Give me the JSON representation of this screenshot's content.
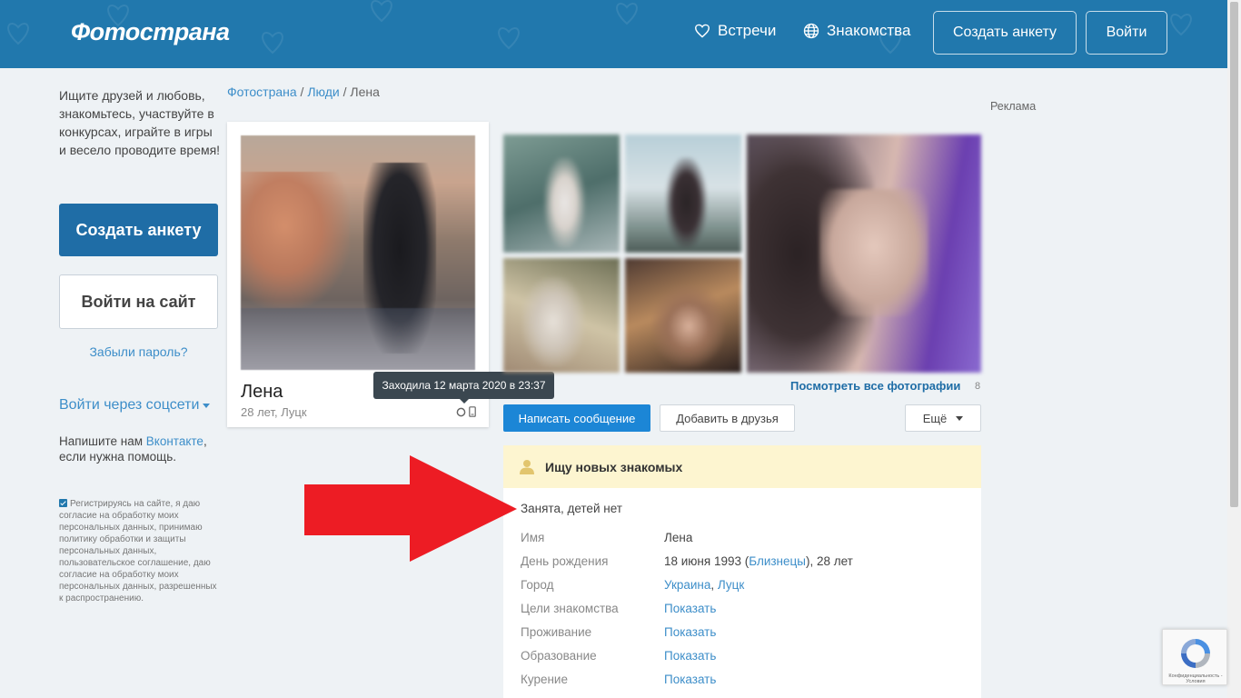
{
  "header": {
    "logo": "Фотострана",
    "nav": [
      {
        "label": "Встречи",
        "icon": "heart-icon"
      },
      {
        "label": "Знакомства",
        "icon": "globe-icon"
      }
    ],
    "create_btn": "Создать анкету",
    "login_btn": "Войти"
  },
  "sidebar": {
    "intro": "Ищите друзей и любовь, знакомьтесь, участвуйте в конкурсах, играйте в игры и весело проводите время!",
    "create_btn": "Создать анкету",
    "login_btn": "Войти на сайт",
    "forgot": "Забыли пароль?",
    "social_login": "Войти через соцсети",
    "write_us_prefix": "Напишите нам ",
    "write_us_link": "Вконтакте",
    "write_us_suffix": ", если нужна помощь.",
    "consent": "Регистрируясь на сайте, я даю согласие на обработку моих персональных данных, принимаю политику обработки и защиты персональных данных, пользовательское соглашение, даю согласие на обработку моих персональных данных, разрешенных к распространению."
  },
  "breadcrumb": {
    "items": [
      "Фотострана",
      "Люди",
      "Лена"
    ],
    "separator": " / "
  },
  "profile": {
    "name": "Лена",
    "subtitle": "28 лет, Луцк",
    "last_seen_tooltip": "Заходила 12 марта 2020 в 23:37"
  },
  "photos": {
    "view_all": "Посмотреть все фотографии",
    "count": "8"
  },
  "actions": {
    "message": "Написать сообщение",
    "add_friend": "Добавить в друзья",
    "more": "Ещё"
  },
  "info": {
    "header": "Ищу новых знакомых",
    "status": "Занята, детей нет",
    "rows": [
      {
        "label": "Имя",
        "value": "Лена"
      },
      {
        "label": "День рождения",
        "value_prefix": "18 июня 1993 (",
        "value_link": "Близнецы",
        "value_suffix": "), 28 лет"
      },
      {
        "label": "Город",
        "value_link": "Украина",
        "value_sep": ", ",
        "value_link2": "Луцк"
      },
      {
        "label": "Цели знакомства",
        "value_link": "Показать"
      },
      {
        "label": "Проживание",
        "value_link": "Показать"
      },
      {
        "label": "Образование",
        "value_link": "Показать"
      },
      {
        "label": "Курение",
        "value_link": "Показать"
      }
    ]
  },
  "ads": {
    "label": "Реклама"
  },
  "recaptcha": {
    "text": "Конфиденциальность - Условия"
  },
  "colors": {
    "header_bg": "#2178ad",
    "primary_button": "#1f6da6",
    "message_button": "#1c86d6",
    "link": "#3d8ec9",
    "info_header_bg": "#fdf5d0",
    "annotation_arrow": "#ed1c24"
  }
}
